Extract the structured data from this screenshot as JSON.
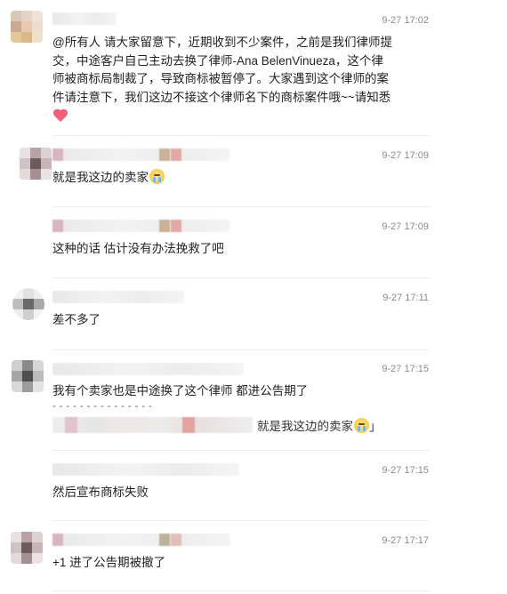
{
  "messages": [
    {
      "time": "9-27 17:02",
      "lines": [
        "@所有人 请大家留意下，近期收到不少案件，之前是我们律师提",
        "交，中途客户自己主动去换了律师-Ana BelenVinueza，这个律",
        "师被商标局制裁了，导致商标被暂停了。大家遇到这个律师的案",
        "件请注意下，我们这边不接这个律师名下的商标案件哦~~请知悉"
      ],
      "emoji": "heart-emoji"
    },
    {
      "time": "9-27 17:09",
      "text": "就是我这边的卖家",
      "emoji": "crying-emoji"
    },
    {
      "time": "9-27 17:09",
      "text": "这种的话 估计没有办法挽救了吧"
    },
    {
      "time": "9-27 17:11",
      "text": "差不多了"
    },
    {
      "time": "9-27 17:15",
      "text": "我有个卖家也是中途换了这个律师  都进公告期了",
      "separator": "- - - - - - - - - - - - - - -",
      "quote": "就是我这边的卖家",
      "quote_emoji": "crying-emoji",
      "quote_end": "」"
    },
    {
      "time": "9-27 17:15",
      "text": "然后宣布商标失败"
    },
    {
      "time": "9-27 17:17",
      "text": "+1  进了公告期被撤了"
    }
  ],
  "colors": {
    "background": "#ffffff",
    "timestamp": "#8a8a8a",
    "divider": "#ececec"
  }
}
